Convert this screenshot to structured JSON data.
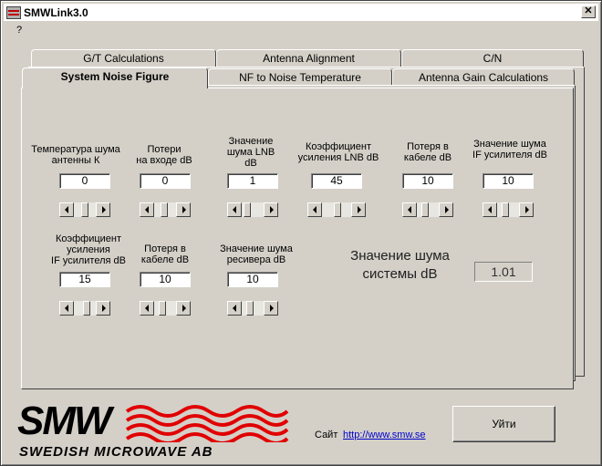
{
  "window": {
    "title": "SMWLink3.0"
  },
  "menu": {
    "help": "?"
  },
  "tabs": {
    "row_back": [
      "G/T Calculations",
      "Antenna Alignment",
      "C/N"
    ],
    "row_front": [
      "System Noise Figure",
      "NF to Noise Temperature",
      "Antenna Gain Calculations"
    ],
    "active": "System Noise Figure"
  },
  "fields": [
    {
      "label": "Температура шума\nантенны К",
      "value": "0",
      "thumb": 0.5
    },
    {
      "label": "Потери\nна входе dB",
      "value": "0",
      "thumb": 0.45
    },
    {
      "label": "Значение\nшума LNB\ndB",
      "value": "1",
      "thumb": 0.1
    },
    {
      "label": "Коэффициент\nусиления  LNB dB",
      "value": "45",
      "thumb": 0.55
    },
    {
      "label": "Потеря в\nкабеле dB",
      "value": "10",
      "thumb": 0.3
    },
    {
      "label": "Значение  шума\nIF усилителя dB",
      "value": "10",
      "thumb": 0.3
    },
    {
      "label": "Коэффициент\nусиления\nIF усилителя dB",
      "value": "15",
      "thumb": 0.6
    },
    {
      "label": "Потеря в\nкабеле dB",
      "value": "10",
      "thumb": 0.3
    },
    {
      "label": "Значение шума\nресивера dB",
      "value": "10",
      "thumb": 0.3
    }
  ],
  "result": {
    "label": "Значение шума\nсистемы dB",
    "value": "1.01"
  },
  "footer": {
    "logo_text": "SMW",
    "logo_sub": "SWEDISH MICROWAVE AB",
    "site_label": "Сайт",
    "site_link": "http://www.smw.se",
    "exit_label": "Уйти"
  },
  "colors": {
    "logo_waves": "#e00000",
    "link": "#0000cc"
  }
}
